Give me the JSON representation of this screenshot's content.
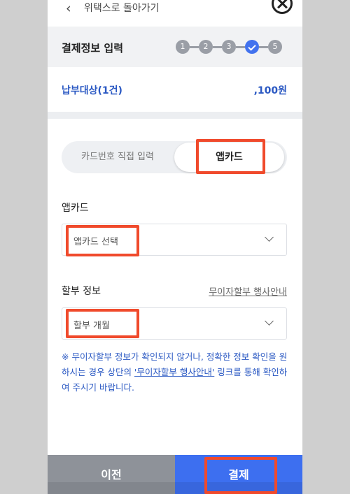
{
  "nav": {
    "back_label": "위택스로 돌아가기"
  },
  "header": {
    "title": "결제정보 입력",
    "steps": [
      "1",
      "2",
      "3",
      "4",
      "5"
    ],
    "active_step": 4
  },
  "payment": {
    "target_label": "납부대상(1건)",
    "amount": ",100원"
  },
  "method_toggle": {
    "manual_label": "카드번호 직접 입력",
    "app_label": "앱카드"
  },
  "appcard": {
    "label": "앱카드",
    "placeholder": "앱카드 선택"
  },
  "installment": {
    "label": "할부 정보",
    "event_link": "무이자할부 행사안내",
    "placeholder": "할부 개월"
  },
  "notice": {
    "part1": "※ 무이자할부 정보가 확인되지 않거나, 정확한 정보 확인을 원하시는 경우 상단의 ",
    "link": "'무이자할부 행사안내'",
    "part2": " 링크를 통해 확인하여 주시기 바랍니다."
  },
  "footer": {
    "prev_label": "이전",
    "pay_label": "결제"
  },
  "colors": {
    "accent": "#3d6ff0",
    "highlight": "#f04a2c",
    "info_text": "#2b59c3"
  }
}
